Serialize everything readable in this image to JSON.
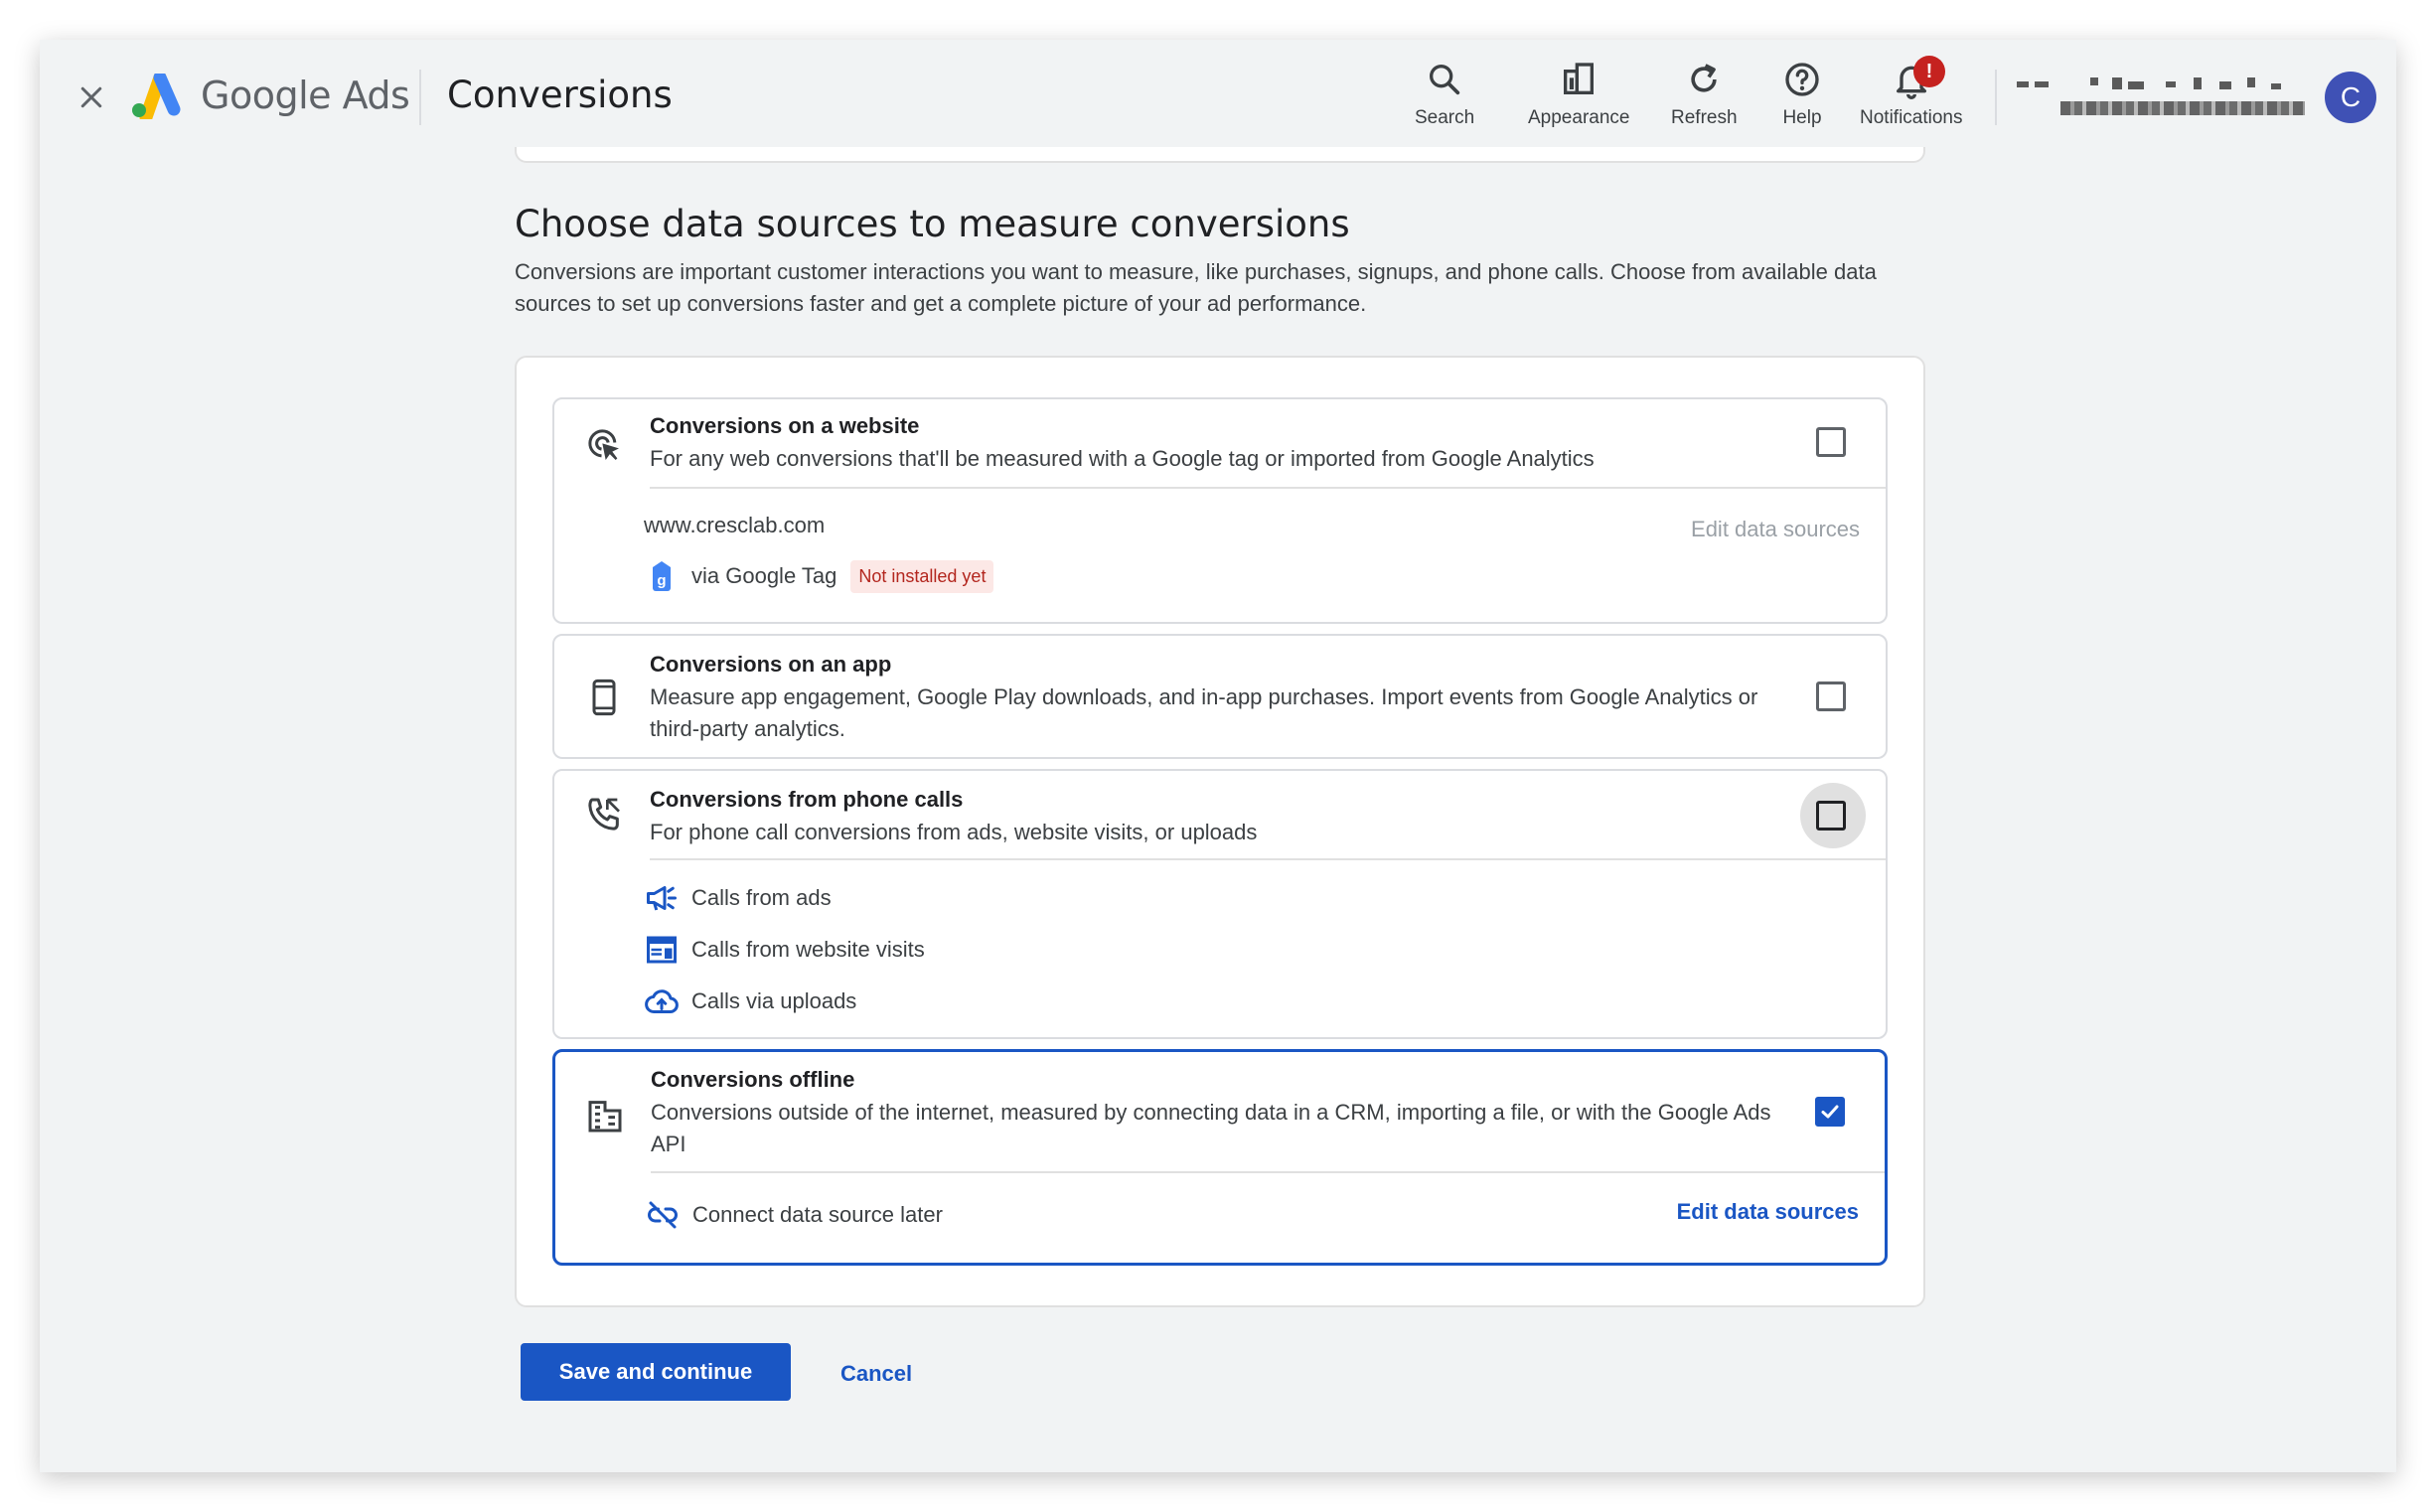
{
  "header": {
    "brand": "Google Ads",
    "page_title": "Conversions",
    "tools": {
      "search": "Search",
      "appearance": "Appearance",
      "refresh": "Refresh",
      "help": "Help",
      "notifications": "Notifications",
      "notifications_badge": "!"
    },
    "avatar_letter": "C"
  },
  "section": {
    "title": "Choose data sources to measure conversions",
    "description": "Conversions are important customer interactions you want to measure, like purchases, signups, and phone calls. Choose from available data sources to set up conversions faster and get a complete picture of your ad performance."
  },
  "options": {
    "website": {
      "title": "Conversions on a website",
      "description": "For any web conversions that'll be measured with a Google tag or imported from Google Analytics",
      "domain": "www.cresclab.com",
      "edit_label": "Edit data sources",
      "via": "via Google Tag",
      "status": "Not installed yet",
      "checked": false
    },
    "app": {
      "title": "Conversions on an app",
      "description": "Measure app engagement, Google Play downloads, and in-app purchases. Import events from Google Analytics or third-party analytics.",
      "checked": false
    },
    "phone": {
      "title": "Conversions from phone calls",
      "description": "For phone call conversions from ads, website visits, or uploads",
      "items": [
        "Calls from ads",
        "Calls from website visits",
        "Calls via uploads"
      ],
      "checked": false
    },
    "offline": {
      "title": "Conversions offline",
      "description": "Conversions outside of the internet, measured by connecting data in a CRM, importing a file, or with the Google Ads API",
      "connect_label": "Connect data source later",
      "edit_label": "Edit data sources",
      "checked": true
    }
  },
  "actions": {
    "save": "Save and continue",
    "cancel": "Cancel"
  },
  "colors": {
    "accent": "#1a56c4",
    "error": "#c5221f",
    "badge_bg": "#fce8e6"
  }
}
